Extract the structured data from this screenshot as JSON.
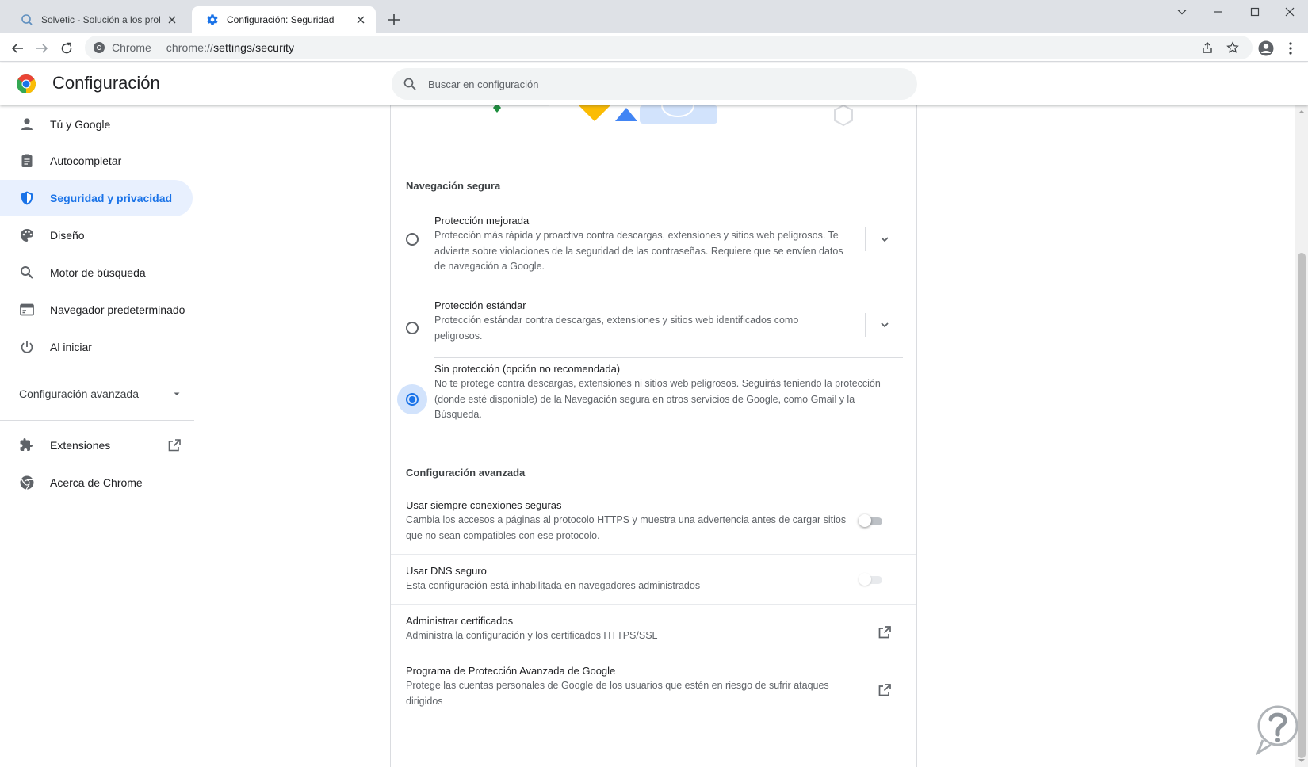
{
  "browser": {
    "tabs": [
      {
        "title": "Solvetic - Solución a los problemas",
        "active": false,
        "icon": "solvetic-favicon"
      },
      {
        "title": "Configuración: Seguridad",
        "active": true,
        "icon": "settings-gear-favicon"
      }
    ],
    "omnibox": {
      "site_label": "Chrome",
      "url_scheme": "chrome://",
      "url_rest": "settings/security"
    }
  },
  "header": {
    "title": "Configuración",
    "search_placeholder": "Buscar en configuración"
  },
  "sidebar": {
    "items": [
      {
        "label": "Tú y Google",
        "icon": "person-icon"
      },
      {
        "label": "Autocompletar",
        "icon": "clipboard-icon"
      },
      {
        "label": "Seguridad y privacidad",
        "icon": "shield-icon",
        "selected": true
      },
      {
        "label": "Diseño",
        "icon": "palette-icon"
      },
      {
        "label": "Motor de búsqueda",
        "icon": "search-icon"
      },
      {
        "label": "Navegador predeterminado",
        "icon": "browser-window-icon"
      },
      {
        "label": "Al iniciar",
        "icon": "power-icon"
      }
    ],
    "advanced_label": "Configuración avanzada",
    "extensions_label": "Extensiones",
    "about_label": "Acerca de Chrome"
  },
  "safe_browsing": {
    "section_title": "Navegación segura",
    "options": [
      {
        "label": "Protección mejorada",
        "description": "Protección más rápida y proactiva contra descargas, extensiones y sitios web peligrosos. Te advierte sobre violaciones de la seguridad de las contraseñas. Requiere que se envíen datos de navegación a Google.",
        "checked": false
      },
      {
        "label": "Protección estándar",
        "description": "Protección estándar contra descargas, extensiones y sitios web identificados como peligrosos.",
        "checked": false
      },
      {
        "label": "Sin protección (opción no recomendada)",
        "description": "No te protege contra descargas, extensiones ni sitios web peligrosos. Seguirás teniendo la protección (donde esté disponible) de la Navegación segura en otros servicios de Google, como Gmail y la Búsqueda.",
        "checked": true
      }
    ]
  },
  "advanced": {
    "section_title": "Configuración avanzada",
    "https_label": "Usar siempre conexiones seguras",
    "https_description": "Cambia los accesos a páginas al protocolo HTTPS y muestra una advertencia antes de cargar sitios que no sean compatibles con ese protocolo.",
    "https_enabled": false,
    "dns_label": "Usar DNS seguro",
    "dns_description": "Esta configuración está inhabilitada en navegadores administrados",
    "dns_enabled": false,
    "dns_disabled": true,
    "certs_label": "Administrar certificados",
    "certs_description": "Administra la configuración y los certificados HTTPS/SSL",
    "app_label": "Programa de Protección Avanzada de Google",
    "app_description": "Protege las cuentas personales de Google de los usuarios que estén en riesgo de sufrir ataques dirigidos"
  },
  "colors": {
    "accent": "#1a73e8",
    "selected_bg": "#e8f0fe",
    "radio_halo": "#d2e3fc"
  }
}
